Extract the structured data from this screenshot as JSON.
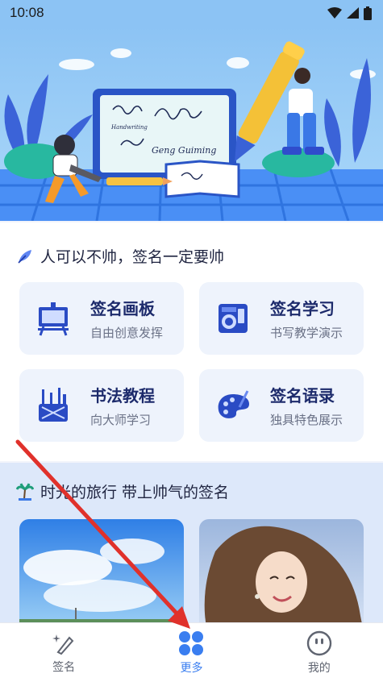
{
  "status_bar": {
    "time": "10:08"
  },
  "banner": {
    "signature_text": "Geng Guiming",
    "note_text": "Handwriting"
  },
  "section_signature": {
    "title": "人可以不帅，签名一定要帅",
    "cards": [
      {
        "title": "签名画板",
        "subtitle": "自由创意发挥",
        "icon": "easel-icon"
      },
      {
        "title": "签名学习",
        "subtitle": "书写教学演示",
        "icon": "notebook-icon"
      },
      {
        "title": "书法教程",
        "subtitle": "向大师学习",
        "icon": "brush-holder-icon"
      },
      {
        "title": "签名语录",
        "subtitle": "独具特色展示",
        "icon": "palette-icon"
      }
    ]
  },
  "section_travel": {
    "title": "时光的旅行 带上帅气的签名"
  },
  "bottom_nav": [
    {
      "label": "签名",
      "icon": "sparkle-pen-icon",
      "active": false
    },
    {
      "label": "更多",
      "icon": "grid-icon",
      "active": true
    },
    {
      "label": "我的",
      "icon": "face-icon",
      "active": false
    }
  ],
  "colors": {
    "accent": "#3a7ef0",
    "banner": "#8cc3f4",
    "card_bg": "#eef3fc",
    "annotation": "#e0312b"
  }
}
